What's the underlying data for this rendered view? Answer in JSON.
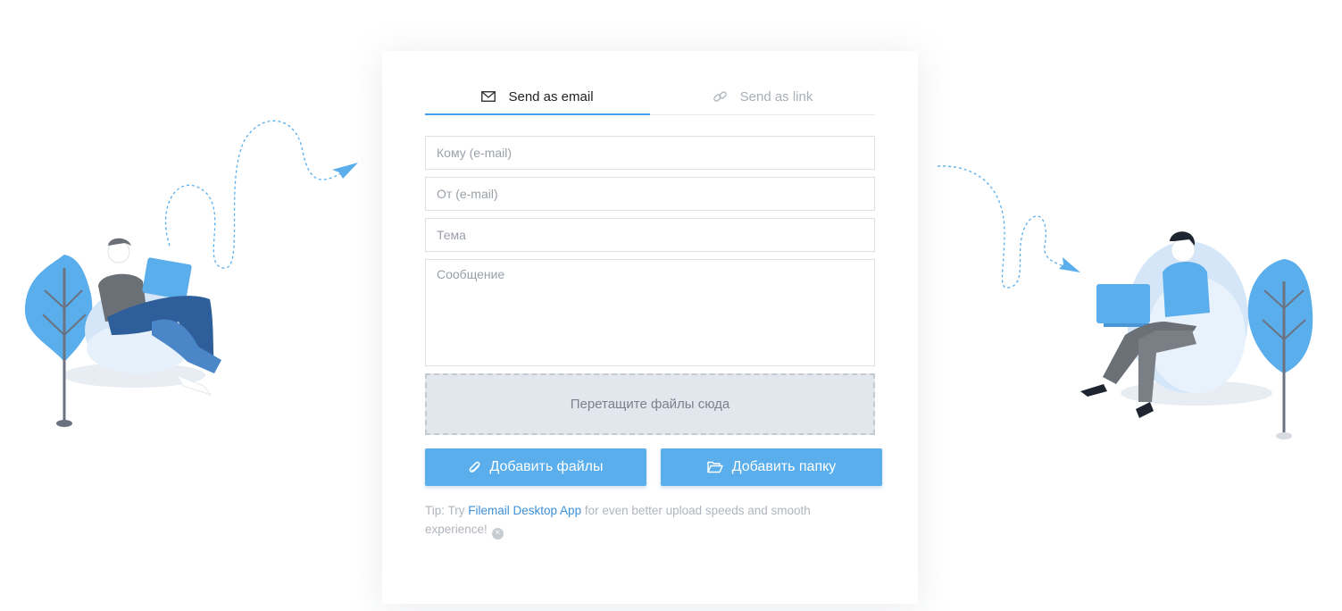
{
  "tabs": [
    {
      "label": "Send as email",
      "icon": "envelope-icon",
      "active": true
    },
    {
      "label": "Send as link",
      "icon": "link-icon",
      "active": false
    }
  ],
  "form": {
    "to_placeholder": "Кому (e-mail)",
    "from_placeholder": "От (e-mail)",
    "subject_placeholder": "Тема",
    "message_placeholder": "Сообщение"
  },
  "dropzone": {
    "label": "Перетащите файлы сюда"
  },
  "buttons": {
    "add_files": "Добавить файлы",
    "add_folder": "Добавить папку"
  },
  "tip": {
    "prefix": "Tip: Try ",
    "link": "Filemail Desktop App",
    "suffix": " for even better upload speeds and smooth experience!"
  },
  "colors": {
    "accent": "#5aaeeb",
    "tab_underline": "#4b9fe8",
    "link": "#3d8fd6",
    "dropzone_bg": "#e1e7ed"
  }
}
